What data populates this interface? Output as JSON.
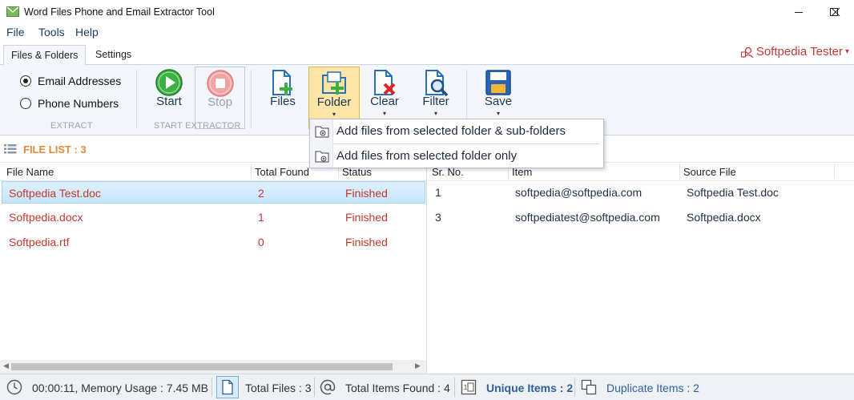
{
  "window": {
    "title": "Word Files Phone and Email Extractor Tool",
    "icon": "envelope-app-icon"
  },
  "menu": {
    "items": [
      "File",
      "Tools",
      "Help"
    ]
  },
  "tabs": [
    {
      "label": "Files & Folders",
      "active": true
    },
    {
      "label": "Settings",
      "active": false
    }
  ],
  "user": {
    "name": "Softpedia Tester",
    "caret": "▾"
  },
  "ribbon": {
    "extract": {
      "options": [
        {
          "label": "Email Addresses",
          "selected": true
        },
        {
          "label": "Phone Numbers",
          "selected": false
        }
      ],
      "group_label": "EXTRACT"
    },
    "start_extractor": {
      "start_label": "Start",
      "stop_label": "Stop",
      "group_label": "START EXTRACTOR"
    },
    "buttons": {
      "files": "Files",
      "folder": "Folder",
      "clear": "Clear",
      "filter": "Filter",
      "save": "Save"
    },
    "dropdown_arrow": "▾"
  },
  "folder_menu": {
    "items": [
      "Add files from selected folder & sub-folders",
      "Add files from selected folder only"
    ]
  },
  "file_list": {
    "heading": "FILE LIST : 3",
    "columns": [
      "File Name",
      "Total Found",
      "Status"
    ],
    "rows": [
      {
        "name": "Softpedia Test.doc",
        "found": "2",
        "status": "Finished",
        "selected": true
      },
      {
        "name": "Softpedia.docx",
        "found": "1",
        "status": "Finished",
        "selected": false
      },
      {
        "name": "Softpedia.rtf",
        "found": "0",
        "status": "Finished",
        "selected": false
      }
    ]
  },
  "results": {
    "columns": [
      "Sr. No.",
      "Item",
      "Source File"
    ],
    "rows": [
      {
        "sr": "1",
        "item": "softpedia@softpedia.com",
        "source": "Softpedia Test.doc"
      },
      {
        "sr": "3",
        "item": "softpediatest@softpedia.com",
        "source": "Softpedia.docx"
      }
    ]
  },
  "status": {
    "time_memory": "00:00:11, Memory Usage : 7.45 MB",
    "total_files": "Total Files : 3",
    "total_items": "Total Items Found : 4",
    "unique_items": "Unique Items : 2",
    "duplicate_items": "Duplicate Items : 2"
  },
  "colors": {
    "accent_orange": "#e08a3a",
    "status_red": "#c0392b",
    "highlight": "#fde5a8",
    "user_red": "#c23a3a"
  }
}
